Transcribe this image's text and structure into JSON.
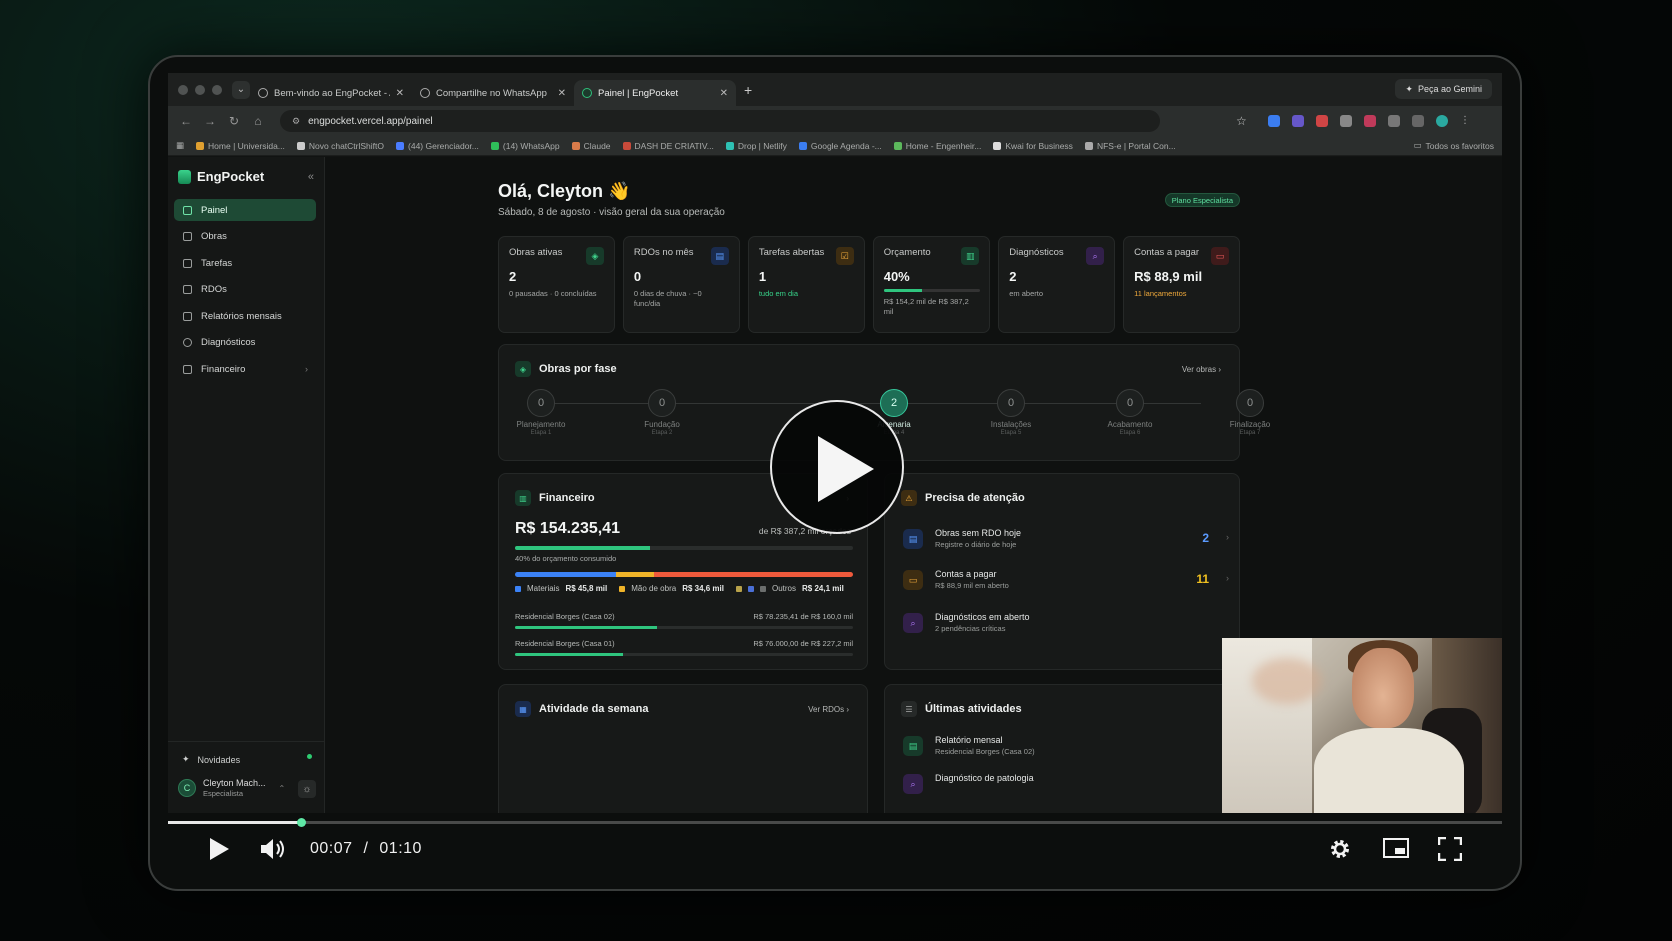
{
  "browser": {
    "tabs": [
      {
        "title": "Bem-vindo ao EngPocket - A",
        "active": false
      },
      {
        "title": "Compartilhe no WhatsApp",
        "active": false
      },
      {
        "title": "Painel | EngPocket",
        "active": true
      }
    ],
    "gemini_label": "Peça ao Gemini",
    "url": "engpocket.vercel.app/painel",
    "bookmarks": [
      "Home | Universida...",
      "Novo chatCtrlShiftO",
      "(44) Gerenciador...",
      "(14) WhatsApp",
      "Claude",
      "DASH DE CRIATIV...",
      "Drop | Netlify",
      "Google Agenda -...",
      "Home - Engenheir...",
      "Kwai for Business",
      "NFS-e | Portal Con..."
    ],
    "all_favorites": "Todos os favoritos"
  },
  "sidebar": {
    "brand": "EngPocket",
    "items": [
      {
        "label": "Painel",
        "icon": "grid-icon",
        "active": true
      },
      {
        "label": "Obras",
        "icon": "layers-icon",
        "active": false
      },
      {
        "label": "Tarefas",
        "icon": "check-square-icon",
        "active": false
      },
      {
        "label": "RDOs",
        "icon": "file-icon",
        "active": false
      },
      {
        "label": "Relatórios mensais",
        "icon": "calendar-icon",
        "active": false
      },
      {
        "label": "Diagnósticos",
        "icon": "search-icon",
        "active": false
      },
      {
        "label": "Financeiro",
        "icon": "bar-chart-icon",
        "active": false
      }
    ],
    "novidades": "Novidades",
    "user": {
      "initial": "C",
      "name": "Cleyton Mach...",
      "role": "Especialista"
    }
  },
  "header": {
    "greeting": "Olá, Cleyton 👋",
    "subtitle": "Sábado, 8 de agosto · visão geral da sua operação",
    "plan": "Plano Especialista"
  },
  "kpis": [
    {
      "label": "Obras ativas",
      "value": "2",
      "sub": "0 pausadas · 0 concluídas",
      "tone": "",
      "color": "#2fc57e"
    },
    {
      "label": "RDOs no mês",
      "value": "0",
      "sub": "0 dias de chuva · ~0 func/dia",
      "tone": "",
      "color": "#3b82f6"
    },
    {
      "label": "Tarefas abertas",
      "value": "1",
      "sub": "tudo em dia",
      "tone": "green",
      "color": "#f0a93b"
    },
    {
      "label": "Orçamento",
      "value": "40%",
      "sub": "R$ 154,2 mil de R$ 387,2 mil",
      "tone": "",
      "color": "#2fc57e",
      "progress": 0.4
    },
    {
      "label": "Diagnósticos",
      "value": "2",
      "sub": "em aberto",
      "tone": "",
      "color": "#a855f7"
    },
    {
      "label": "Contas a pagar",
      "value": "R$ 88,9 mil",
      "sub": "11 lançamentos",
      "tone": "orange",
      "color": "#ef4444"
    }
  ],
  "phases": {
    "title": "Obras por fase",
    "link": "Ver obras",
    "stages": [
      {
        "name": "Planejamento",
        "step": "Etapa 1",
        "count": "0",
        "active": false
      },
      {
        "name": "Fundação",
        "step": "Etapa 2",
        "count": "0",
        "active": false
      },
      {
        "name": "",
        "step": "",
        "count": "",
        "active": false
      },
      {
        "name": "Alvenaria",
        "step": "Etapa 4",
        "count": "2",
        "active": true
      },
      {
        "name": "Instalações",
        "step": "Etapa 5",
        "count": "0",
        "active": false
      },
      {
        "name": "Acabamento",
        "step": "Etapa 6",
        "count": "0",
        "active": false
      },
      {
        "name": "Finalização",
        "step": "Etapa 7",
        "count": "0",
        "active": false
      }
    ]
  },
  "financeiro": {
    "title": "Financeiro",
    "total": "R$ 154.235,41",
    "of_budget": "de R$ 387,2 mil orçados",
    "pct_text": "40% do orçamento consumido",
    "pct": 0.4,
    "breakdown": [
      {
        "label": "Materiais",
        "value": "R$ 45,8 mil",
        "color": "#3b82f6",
        "share": 0.3
      },
      {
        "label": "Mão de obra",
        "value": "R$ 34,6 mil",
        "color": "#f0b429",
        "share": 0.11
      },
      {
        "label": "Outros",
        "value": "R$ 24,1 mil",
        "color": "#ef5a3c",
        "share": 0.59
      }
    ],
    "projects": [
      {
        "name": "Residencial Borges (Casa 02)",
        "value": "R$ 78.235,41 de R$ 160,0 mil",
        "pct": 0.42
      },
      {
        "name": "Residencial Borges (Casa 01)",
        "value": "R$ 76.000,00 de R$ 227,2 mil",
        "pct": 0.32
      }
    ]
  },
  "atencao": {
    "title": "Precisa de atenção",
    "items": [
      {
        "title": "Obras sem RDO hoje",
        "sub": "Registre o diário de hoje",
        "count": "2",
        "color": "#4a8ff7",
        "icon": "file-icon"
      },
      {
        "title": "Contas a pagar",
        "sub": "R$ 88,9 mil em aberto",
        "count": "11",
        "color": "#f0b429",
        "icon": "wallet-icon"
      },
      {
        "title": "Diagnósticos em aberto",
        "sub": "2 pendências críticas",
        "count": "",
        "color": "#a855f7",
        "icon": "search-icon"
      }
    ]
  },
  "atividade": {
    "title": "Atividade da semana",
    "link": "Ver RDOs"
  },
  "ultimas": {
    "title": "Últimas atividades",
    "items": [
      {
        "title": "Relatório mensal",
        "sub": "Residencial Borges (Casa 02)"
      },
      {
        "title": "Diagnóstico de patologia",
        "sub": ""
      }
    ]
  },
  "player": {
    "current": "00:07",
    "separator": "/",
    "duration": "01:10",
    "progress": 0.1
  }
}
